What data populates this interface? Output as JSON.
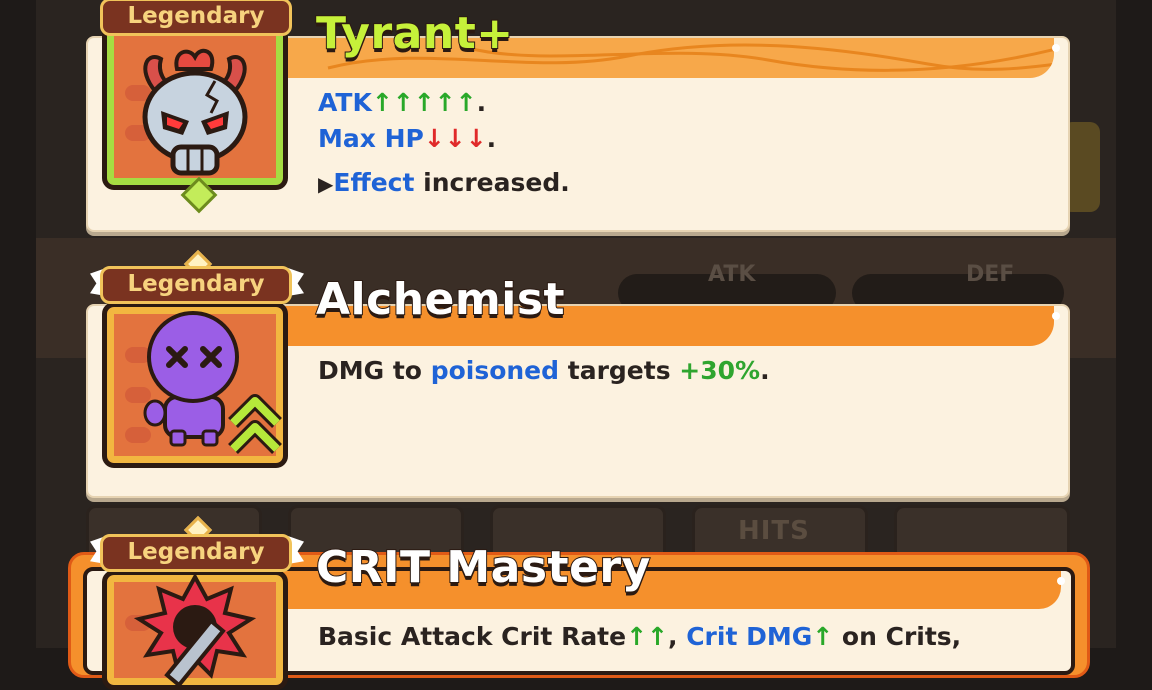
{
  "background": {
    "stats": [
      {
        "label": "ATK"
      },
      {
        "label": "DEF"
      }
    ],
    "tile_label": "HITS"
  },
  "cards": [
    {
      "rarity": "Legendary",
      "title": "Tyrant+",
      "title_color": "#c6f13a",
      "icon": "demon-skull-icon",
      "lines": {
        "atk": "ATK",
        "atk_arrows": "↑↑↑↑↑",
        "atk_end": ".",
        "hp": "Max HP",
        "hp_arrows": "↓↓↓",
        "hp_end": ".",
        "marker": "▶",
        "effect": "Effect",
        "effect_rest": " increased."
      }
    },
    {
      "rarity": "Legendary",
      "title": "Alchemist",
      "title_color": "#ffffff",
      "icon": "purple-dummy-icon",
      "upgrade_icon": "double-chevron-up-icon",
      "lines": {
        "p1": "DMG to ",
        "p2": "poisoned",
        "p3": " targets ",
        "p4": "+30%",
        "p5": "."
      }
    },
    {
      "rarity": "Legendary",
      "title": "CRIT Mastery",
      "title_color": "#ffffff",
      "icon": "sword-burst-icon",
      "lines": {
        "p1": "Basic Attack Crit Rate",
        "p1_arrows": "↑↑",
        "p2": ", ",
        "p3": "Crit DMG",
        "p3_arrows": "↑",
        "p4": " on Crits,"
      }
    }
  ],
  "colors": {
    "accent_orange": "#f5902c",
    "card_bg": "#fcf2e0",
    "text_blue": "#1f63d6",
    "text_green": "#2fa52f",
    "arrow_red": "#e02a2a"
  }
}
